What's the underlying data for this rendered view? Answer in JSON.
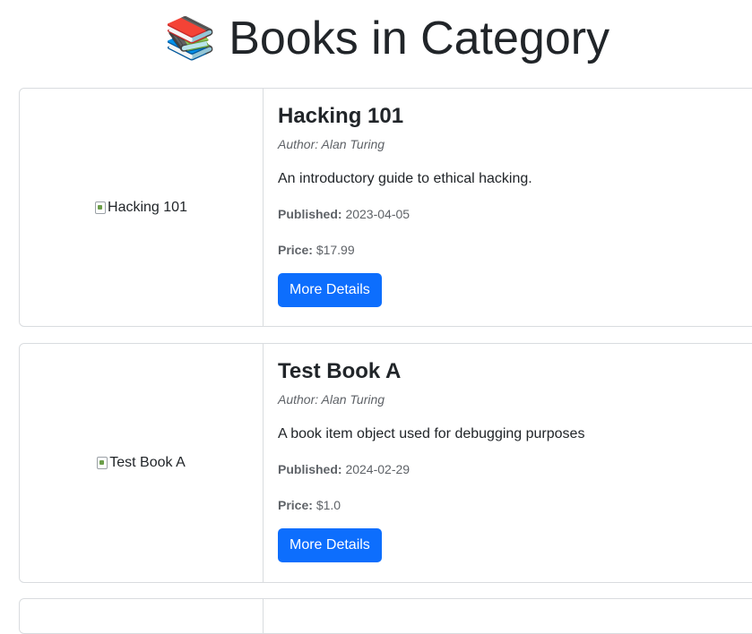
{
  "page": {
    "title_emoji": "📚",
    "title": "Books in Category"
  },
  "books": [
    {
      "title": "Hacking 101",
      "image_alt": "Hacking 101",
      "author": "Author: Alan Turing",
      "description": "An introductory guide to ethical hacking.",
      "published_label": "Published:",
      "published": "2023-04-05",
      "price_label": "Price:",
      "price": "$17.99",
      "button_label": "More Details"
    },
    {
      "title": "Test Book A",
      "image_alt": "Test Book A",
      "author": "Author: Alan Turing",
      "description": "A book item object used for debugging purposes",
      "published_label": "Published:",
      "published": "2024-02-29",
      "price_label": "Price:",
      "price": "$1.0",
      "button_label": "More Details"
    }
  ],
  "colors": {
    "button_bg": "#0d6efd",
    "card_border": "#d9dcdf"
  }
}
